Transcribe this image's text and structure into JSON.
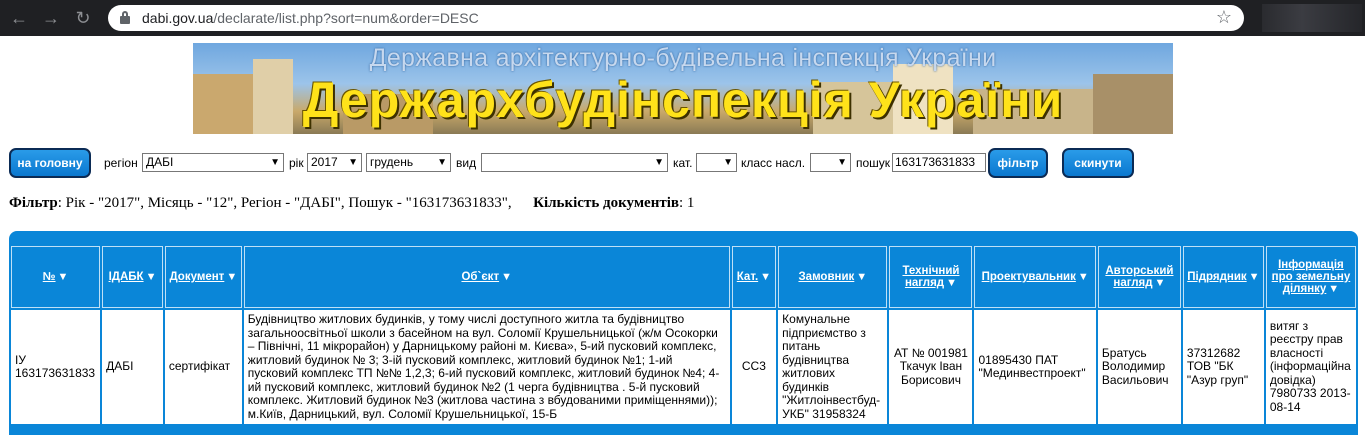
{
  "browser": {
    "url_host": "dabi.gov.ua",
    "url_path": "/declarate/list.php?sort=num&order=DESC"
  },
  "banner": {
    "subtitle": "Державна архітектурно-будівельна інспекція України",
    "title": "Держархбудінспекція України"
  },
  "toolbar": {
    "home_label": "на головну",
    "region_label": "регіон",
    "region_value": "ДАБІ",
    "year_label": "рік",
    "year_value": "2017",
    "month_value": "грудень",
    "type_label": "вид",
    "type_value": "",
    "cat_label": "кат.",
    "cat_value": "",
    "class_label": "класс насл.",
    "class_value": "",
    "search_label": "пошук",
    "search_value": "163173631833",
    "filter_label": "фільтр",
    "reset_label": "скинути"
  },
  "filter": {
    "label": "Фільтр",
    "text": ": Рік - \"2017\", Місяць - \"12\", Регіон - \"ДАБІ\", Пошук - \"163173631833\",",
    "count_label": "Кількість документів",
    "count_value": ": 1"
  },
  "table": {
    "columns": [
      {
        "label": "№"
      },
      {
        "label": "ІДАБК"
      },
      {
        "label": "Документ"
      },
      {
        "label": "Об`єкт"
      },
      {
        "label": "Кат."
      },
      {
        "label": "Замовник"
      },
      {
        "label": "Технічний нагляд"
      },
      {
        "label": "Проектувальник"
      },
      {
        "label": "Авторський нагляд"
      },
      {
        "label": "Підрядник"
      },
      {
        "label": "Інформація про земельну ділянку"
      }
    ],
    "rows": [
      {
        "num": "ІУ 163173631833",
        "idabk": "ДАБІ",
        "document": "сертифікат",
        "object": "Будівництво житлових будинків, у тому числі доступного житла та будівництво загальноосвітньої школи з басейном на вул. Соломії Крушельницької (ж/м Осокорки – Північні, 11 мікрорайон) у Дарницькому районі м. Києва», 5-ий пусковий комплекс, житловий будинок № 3; 3-ій пусковий комплекс, житловий будинок №1; 1-ий пусковий комплекс ТП №№ 1,2,3; 6-ий пусковий комплекс, житловий будинок №4; 4-ий пусковий комплекс, житловий будинок №2 (1 черга будівництва . 5-й пусковий комплекс. Житловий будинок №3 (житлова частина з вбудованими приміщеннями)); м.Київ, Дарницький, вул. Соломії Крушельницької, 15-Б",
        "category": "СС3",
        "customer": "Комунальне підприємство з питань будівництва житлових будинків \"Житлоінвестбуд-УКБ\" 31958324",
        "tech_supervision": "АТ № 001981 Ткачук Іван Борисович",
        "designer": "01895430 ПАТ \"Мединвестпроект\"",
        "author_supervision": "Братусь Володимир Васильович",
        "contractor": "37312682 ТОВ \"БК \"Азур груп\"",
        "land_info": "витяг з реєстру прав власності (інформаційна довідка) 7980733 2013-08-14"
      }
    ]
  },
  "colors": {
    "table_header": "#0a86d8",
    "button": "#1a8ae0",
    "banner_title": "#ffe21a"
  }
}
